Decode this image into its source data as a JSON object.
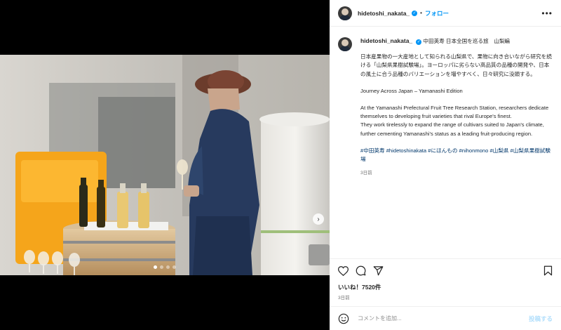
{
  "header": {
    "username": "hidetoshi_nakata_",
    "separator": "•",
    "follow_label": "フォロー",
    "more_label": "•••"
  },
  "caption": {
    "username": "hidetoshi_nakata_",
    "title": "中田英寿 日本全国を巡る旅　山梨編",
    "para_jp": "日本産果物の一大産地として知られる山梨県で、果物に向き合いながら研究を続ける「山梨県果樹試験場」。ヨーロッパに劣らない高品質の品種の開発や、日本の風土に合う品種のバリエーションを増やすべく、日々研究に没頭する。",
    "para_en_title": "Journey Across Japan – Yamanashi Edition",
    "para_en_1": "At the Yamanashi Prefectural Fruit Tree Research Station, researchers dedicate themselves to developing fruit varieties that rival Europe's finest.",
    "para_en_2": "They work tirelessly to expand the range of cultivars suited to Japan's climate, further cementing Yamanashi's status as a leading fruit-producing region.",
    "tags": "#中田英寿 #hidetoshinakata #にほんもの #nihonmono #山梨県 #山梨県果樹試験場",
    "time": "3日前"
  },
  "media": {
    "slide_count": 4,
    "active_slide": 1,
    "next_label": "›"
  },
  "stats": {
    "likes": "いいね！7520件",
    "date": "3日前"
  },
  "comment": {
    "placeholder": "コメントを追加...",
    "post_label": "投稿する"
  },
  "colors": {
    "accent": "#0095f6",
    "link": "#00376b",
    "muted": "#737373"
  }
}
